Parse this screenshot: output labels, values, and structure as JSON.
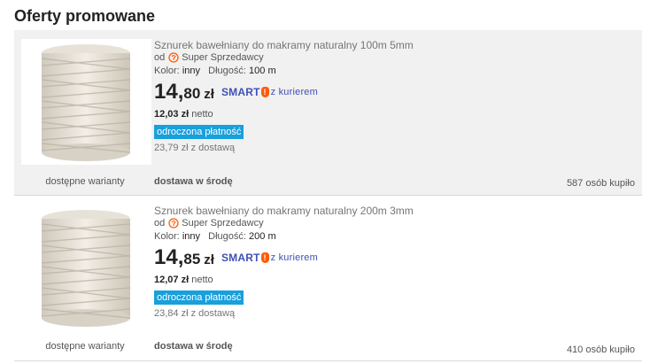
{
  "section_title": "Oferty promowane",
  "offers": [
    {
      "title": "Sznurek bawełniany do makramy naturalny 100m 5mm",
      "seller_prefix": "od",
      "seller_label": "Super Sprzedawcy",
      "seller_icon": "super-seller-badge-icon",
      "color_label": "Kolor:",
      "color_value": "inny",
      "length_label": "Długość:",
      "length_value": "100 m",
      "price_int": "14,",
      "price_frac": "80",
      "currency": "zł",
      "smart_label": "SMART",
      "smart_bang": "!",
      "smart_courier": "z kurierem",
      "netto_value": "12,03 zł",
      "netto_label": "netto",
      "deferred_payment": "odroczona płatność",
      "with_shipping": "23,79 zł z dostawą",
      "delivery": "dostawa w środę",
      "variants": "dostępne warianty",
      "bought": "587 osób kupiło"
    },
    {
      "title": "Sznurek bawełniany do makramy naturalny 200m 3mm",
      "seller_prefix": "od",
      "seller_label": "Super Sprzedawcy",
      "seller_icon": "super-seller-badge-icon",
      "color_label": "Kolor:",
      "color_value": "inny",
      "length_label": "Długość:",
      "length_value": "200 m",
      "price_int": "14,",
      "price_frac": "85",
      "currency": "zł",
      "smart_label": "SMART",
      "smart_bang": "!",
      "smart_courier": "z kurierem",
      "netto_value": "12,07 zł",
      "netto_label": "netto",
      "deferred_payment": "odroczona płatność",
      "with_shipping": "23,84 zł z dostawą",
      "delivery": "dostawa w środę",
      "variants": "dostępne warianty",
      "bought": "410 osób kupiło"
    }
  ],
  "colors": {
    "smart_brand": "#3f51b5",
    "smart_accent": "#ff5a00",
    "deferred_badge": "#18a0dc",
    "promoted_bg": "#f1f1f1"
  }
}
